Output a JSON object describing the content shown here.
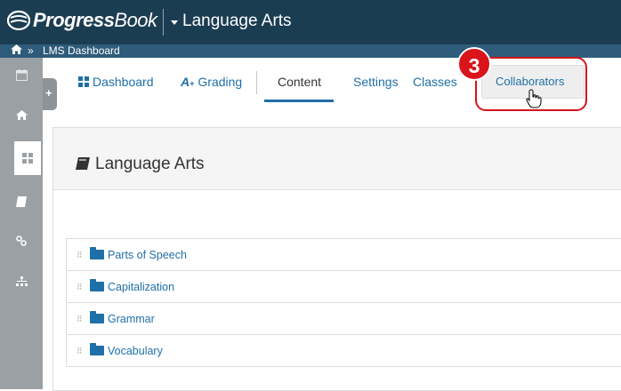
{
  "header": {
    "logo_bold": "Progress",
    "logo_rest": "Book",
    "course": "Language Arts"
  },
  "breadcrumb": {
    "separator": "»",
    "label": "LMS Dashboard"
  },
  "nav": {
    "tabs": [
      {
        "label": "Dashboard",
        "icon": "grid-icon"
      },
      {
        "label": "Grading",
        "icon": "grade-a-plus-icon"
      },
      {
        "label": "Content",
        "active": true
      },
      {
        "label": "Settings"
      },
      {
        "label": "Classes"
      },
      {
        "label": "Collaborators",
        "icon": "pointer-hand-icon"
      }
    ]
  },
  "annotation": {
    "step_number": "3",
    "highlight_color": "#d4141b"
  },
  "panel": {
    "title": "Language Arts",
    "folders": [
      {
        "label": "Parts of Speech"
      },
      {
        "label": "Capitalization"
      },
      {
        "label": "Grammar"
      },
      {
        "label": "Vocabulary"
      }
    ]
  },
  "colors": {
    "topbar": "#1b3d52",
    "accent": "#1f6fa8",
    "sidebar": "#9aa0a4"
  }
}
